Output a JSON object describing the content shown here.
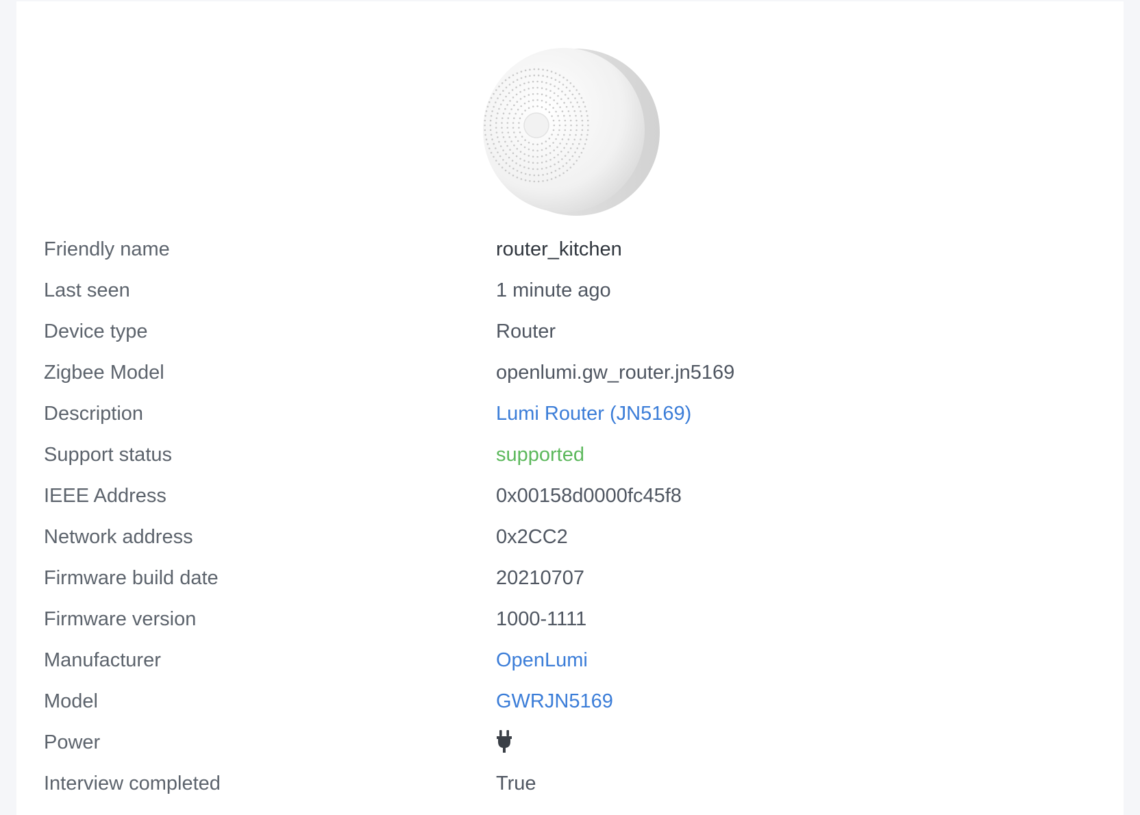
{
  "device": {
    "image_alt": "white round zigbee router",
    "colors": {
      "link": "#3b7dd8",
      "supported": "#5cb85c",
      "label": "#5c636c",
      "value": "#4f5661"
    }
  },
  "rows": [
    {
      "label": "Friendly name",
      "value": "router_kitchen"
    },
    {
      "label": "Last seen",
      "value": "1 minute ago"
    },
    {
      "label": "Device type",
      "value": "Router"
    },
    {
      "label": "Zigbee Model",
      "value": "openlumi.gw_router.jn5169"
    },
    {
      "label": "Description",
      "value": "Lumi Router (JN5169)"
    },
    {
      "label": "Support status",
      "value": "supported"
    },
    {
      "label": "IEEE Address",
      "value": "0x00158d0000fc45f8"
    },
    {
      "label": "Network address",
      "value": "0x2CC2"
    },
    {
      "label": "Firmware build date",
      "value": "20210707"
    },
    {
      "label": "Firmware version",
      "value": "1000-1111"
    },
    {
      "label": "Manufacturer",
      "value": "OpenLumi"
    },
    {
      "label": "Model",
      "value": "GWRJN5169"
    },
    {
      "label": "Power",
      "icon": "plug-icon"
    },
    {
      "label": "Interview completed",
      "value": "True"
    }
  ]
}
